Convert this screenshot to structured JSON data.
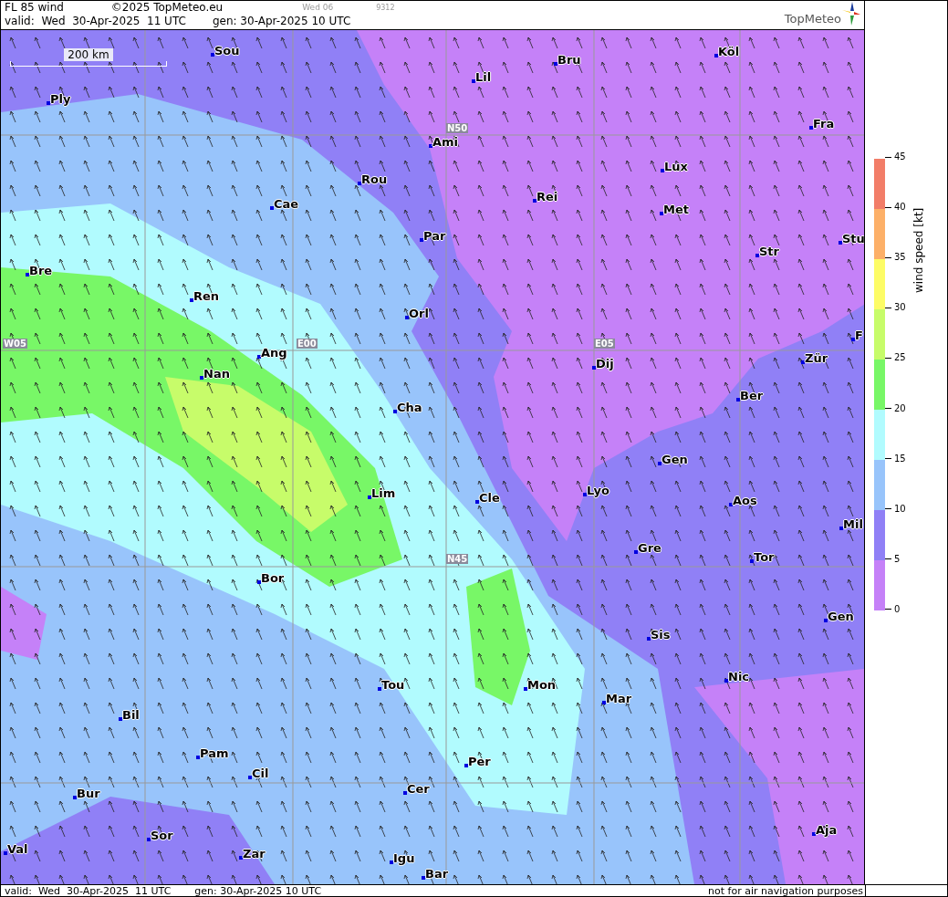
{
  "header": {
    "title": "FL 85 wind",
    "copyright": "©2025 TopMeteo.eu",
    "day_code": "Wed 06",
    "number": "9312",
    "valid": "valid:  Wed  30-Apr-2025  11 UTC",
    "generated": "gen: 30-Apr-2025 10 UTC",
    "logo": "TopMeteo"
  },
  "map": {
    "scale": "200 km",
    "grid_labels": [
      "N50",
      "W05",
      "E00",
      "E05",
      "N45"
    ],
    "cities": [
      "Sou",
      "Bru",
      "Köl",
      "Lil",
      "Ply",
      "Fra",
      "Ami",
      "Lux",
      "Rou",
      "Cae",
      "Rei",
      "Met",
      "Par",
      "Stu",
      "Str",
      "Bre",
      "Ren",
      "Orl",
      "F",
      "Ang",
      "Dij",
      "Zür",
      "Nan",
      "Ber",
      "Cha",
      "Gen",
      "Lim",
      "Cle",
      "Lyo",
      "Aos",
      "Mil",
      "Gre",
      "Tor",
      "Bor",
      "Gen",
      "Sis",
      "Tou",
      "Nic",
      "Mon",
      "Mar",
      "Bil",
      "Pam",
      "Per",
      "Cil",
      "Cer",
      "Bur",
      "Sor",
      "Aja",
      "Val",
      "Zar",
      "Igu",
      "Bar"
    ]
  },
  "legend": {
    "title": "wind speed [kt]",
    "ticks": [
      "45",
      "40",
      "35",
      "30",
      "25",
      "20",
      "15",
      "10",
      "5",
      "0"
    ],
    "bands": [
      {
        "color": "#f27d68"
      },
      {
        "color": "#fdb068"
      },
      {
        "color": "#fdfc66"
      },
      {
        "color": "#c7fc6a"
      },
      {
        "color": "#78f767"
      },
      {
        "color": "#b1fbfe"
      },
      {
        "color": "#98c4fb"
      },
      {
        "color": "#9080f6"
      },
      {
        "color": "#c581f8"
      }
    ]
  },
  "footer": {
    "valid": "valid:  Wed  30-Apr-2025  11 UTC",
    "generated": "gen: 30-Apr-2025 10 UTC",
    "note": "not for air navigation purposes"
  }
}
